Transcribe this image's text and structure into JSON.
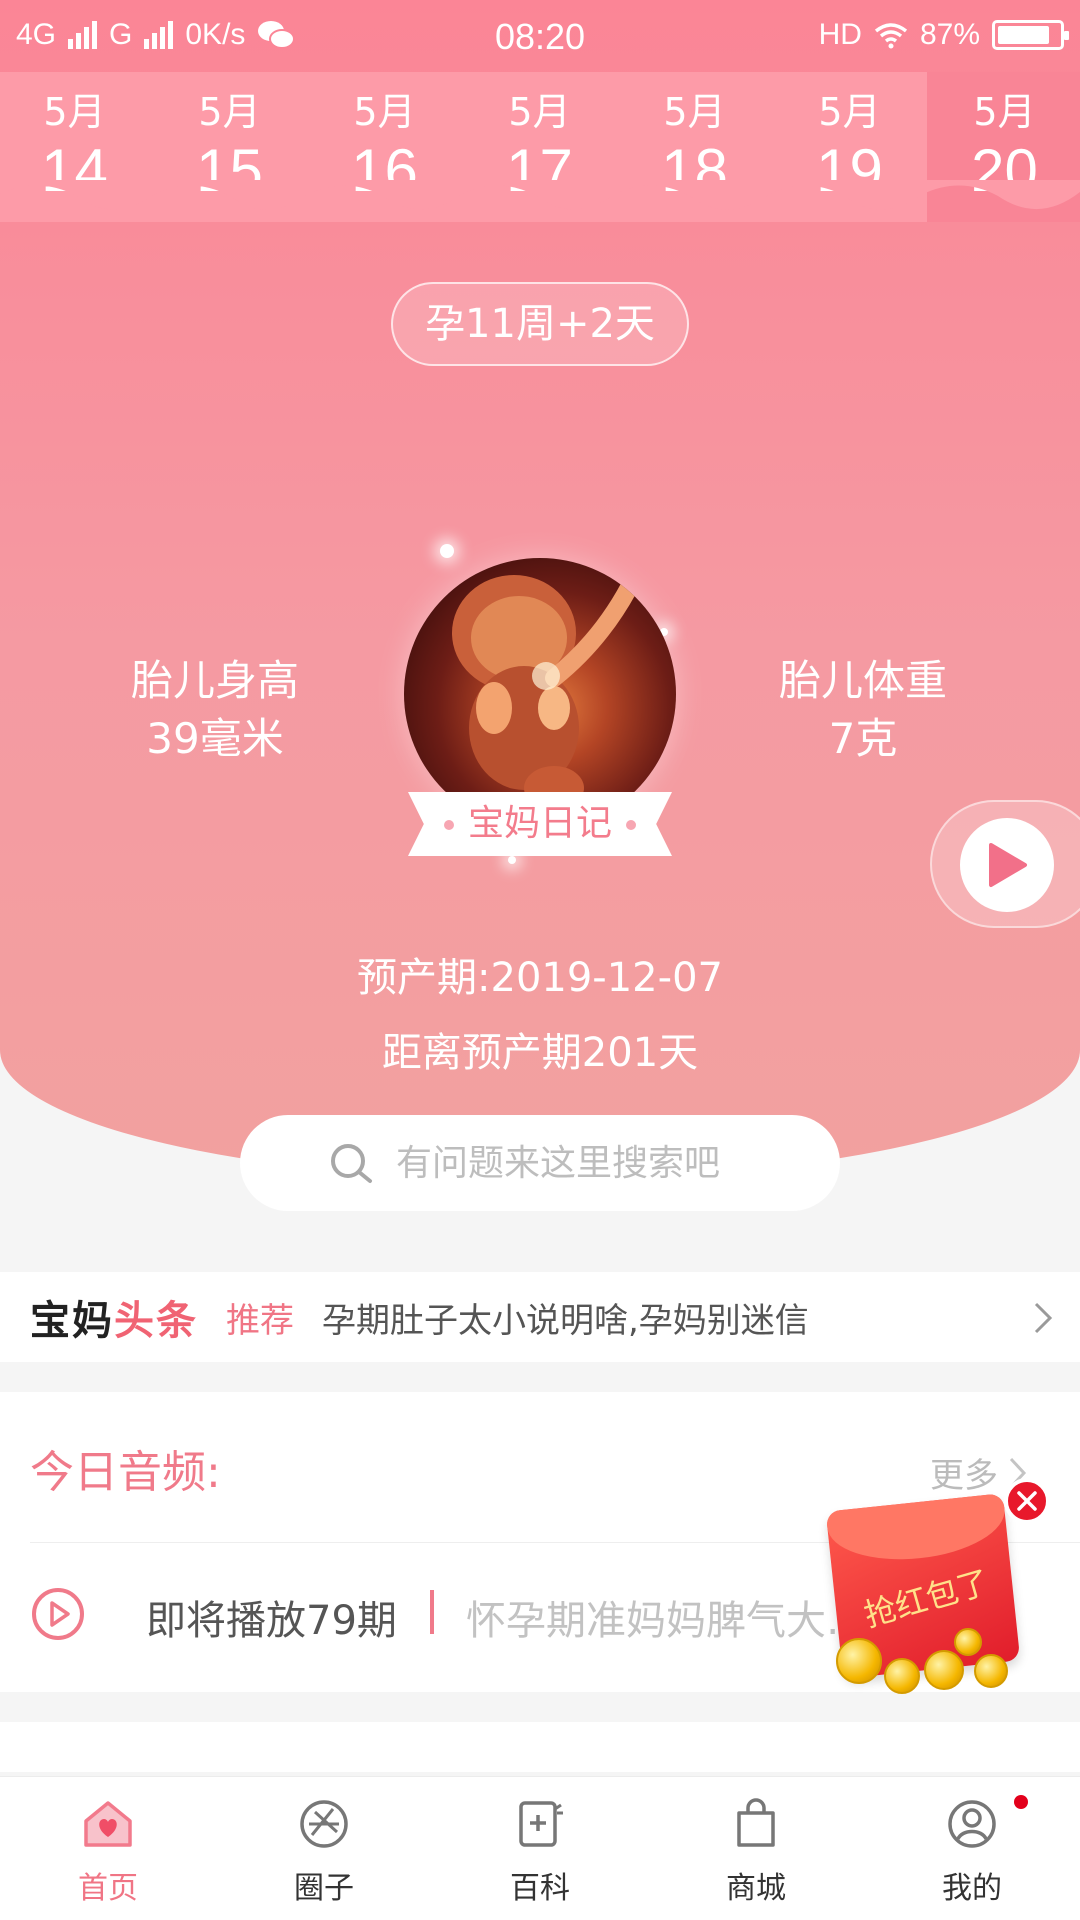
{
  "status_bar": {
    "network1": "4G",
    "network2": "G",
    "speed": "0K/s",
    "time": "08:20",
    "hd": "HD",
    "battery": "87%",
    "battery_level": 0.87
  },
  "dates": [
    {
      "month": "5月",
      "day": "14"
    },
    {
      "month": "5月",
      "day": "15"
    },
    {
      "month": "5月",
      "day": "16"
    },
    {
      "month": "5月",
      "day": "17"
    },
    {
      "month": "5月",
      "day": "18"
    },
    {
      "month": "5月",
      "day": "19"
    },
    {
      "month": "5月",
      "day": "20"
    }
  ],
  "selected_date_index": 6,
  "pregnancy": {
    "week_label": "孕11周+2天",
    "height_label": "胎儿身高",
    "height_value": "39毫米",
    "weight_label": "胎儿体重",
    "weight_value": "7克",
    "diary_label": "宝妈日记",
    "due_date": "预产期:2019-12-07",
    "days_left": "距离预产期201天"
  },
  "search": {
    "placeholder": "有问题来这里搜索吧"
  },
  "headline": {
    "brand_a": "宝妈",
    "brand_b": "头条",
    "tag": "推荐",
    "text": "孕期肚子太小说明啥,孕妈别迷信"
  },
  "audio": {
    "title": "今日音频:",
    "more": "更多",
    "episode": "即将播放79期",
    "track_title": "怀孕期准妈妈脾气大…"
  },
  "promo": {
    "label": "抢红包了"
  },
  "tabbar": [
    {
      "label": "首页",
      "icon": "home-heart-icon",
      "active": true
    },
    {
      "label": "圈子",
      "icon": "circle-aperture-icon",
      "active": false
    },
    {
      "label": "百科",
      "icon": "encyclopedia-icon",
      "active": false
    },
    {
      "label": "商城",
      "icon": "shopping-bag-icon",
      "active": false
    },
    {
      "label": "我的",
      "icon": "profile-icon",
      "active": false
    }
  ],
  "colors": {
    "brand_pink": "#f98596",
    "accent_text": "#f07585",
    "notification_dot": "#e3001b"
  }
}
